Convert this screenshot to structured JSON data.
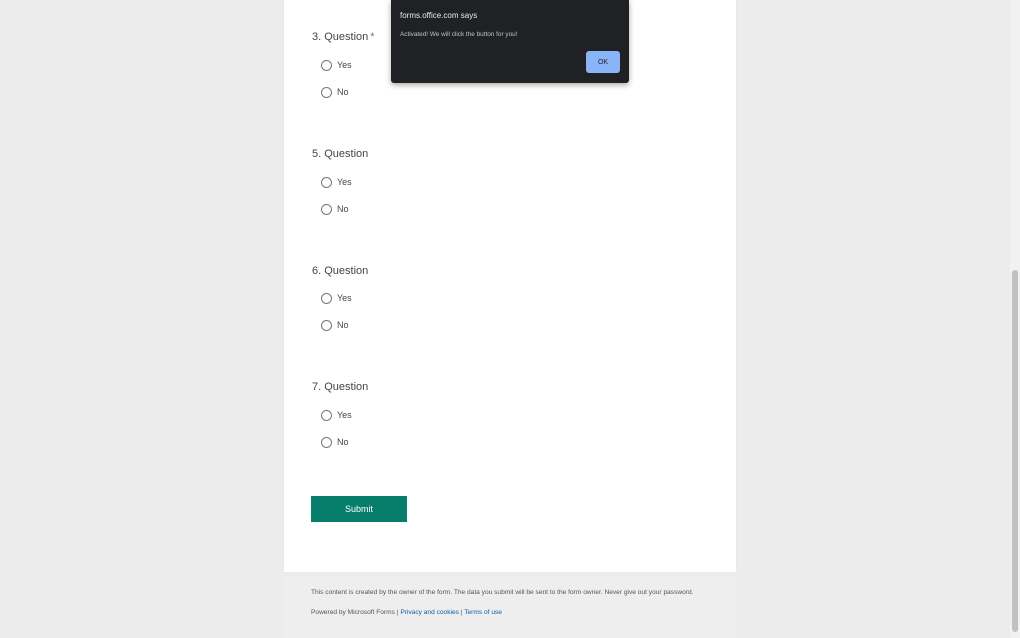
{
  "form": {
    "questions": [
      {
        "title": "3. Question",
        "required_mark": "*",
        "options": [
          "Yes",
          "No"
        ]
      },
      {
        "title": "5. Question",
        "required_mark": "",
        "options": [
          "Yes",
          "No"
        ]
      },
      {
        "title": "6. Question",
        "required_mark": "",
        "options": [
          "Yes",
          "No"
        ]
      },
      {
        "title": "7. Question",
        "required_mark": "",
        "options": [
          "Yes",
          "No"
        ]
      }
    ],
    "submit_label": "Submit"
  },
  "footer": {
    "disclaimer": "This content is created by the owner of the form. The data you submit will be sent to the form owner. Never give out your password.",
    "powered_by": "Powered by Microsoft Forms",
    "separator": " | ",
    "privacy_link": "Privacy and cookies",
    "terms_link": "Terms of use"
  },
  "alert": {
    "title": "forms.office.com says",
    "message": "Activated! We will click the button for you!",
    "ok_label": "OK"
  },
  "colors": {
    "submit_button": "#077d6b",
    "dialog_background": "#202124",
    "dialog_ok_button": "#8ab4f8",
    "page_background": "#ececec"
  }
}
